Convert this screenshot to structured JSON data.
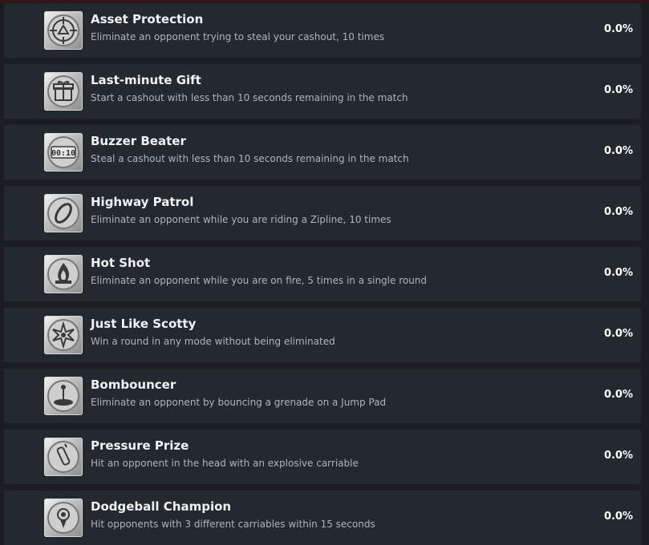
{
  "achievements": [
    {
      "title": "Asset Protection",
      "description": "Eliminate an opponent trying to steal your cashout, 10 times",
      "percent": "0.0%",
      "icon": "crosshair-icon"
    },
    {
      "title": "Last-minute Gift",
      "description": "Start a cashout with less than 10 seconds remaining in the match",
      "percent": "0.0%",
      "icon": "gift-icon"
    },
    {
      "title": "Buzzer Beater",
      "description": "Steal a cashout with less than 10 seconds remaining in the match",
      "percent": "0.0%",
      "icon": "timer-icon",
      "icon_text": "00:10"
    },
    {
      "title": "Highway Patrol",
      "description": "Eliminate an opponent while you are riding a Zipline, 10 times",
      "percent": "0.0%",
      "icon": "zipline-icon"
    },
    {
      "title": "Hot Shot",
      "description": "Eliminate an opponent while you are on fire, 5 times in a single round",
      "percent": "0.0%",
      "icon": "fire-icon"
    },
    {
      "title": "Just Like Scotty",
      "description": "Win a round in any mode without being eliminated",
      "percent": "0.0%",
      "icon": "star-burst-icon"
    },
    {
      "title": "Bombouncer",
      "description": "Eliminate an opponent by bouncing a grenade on a Jump Pad",
      "percent": "0.0%",
      "icon": "jump-pad-icon"
    },
    {
      "title": "Pressure Prize",
      "description": "Hit an opponent in the head with an explosive carriable",
      "percent": "0.0%",
      "icon": "canister-icon"
    },
    {
      "title": "Dodgeball Champion",
      "description": "Hit opponents with 3 different carriables within 15 seconds",
      "percent": "0.0%",
      "icon": "medal-icon"
    }
  ]
}
